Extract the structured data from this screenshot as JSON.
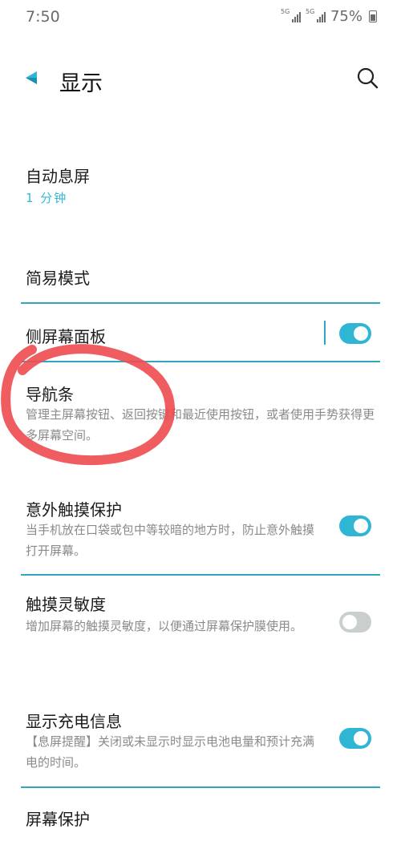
{
  "status_bar": {
    "time": "7:50",
    "sim1": "5G",
    "sim2": "5G",
    "battery": "75%"
  },
  "header": {
    "title": "显示"
  },
  "items": [
    {
      "title": "自动息屏",
      "value": "1 分钟"
    },
    {
      "title": "简易模式"
    },
    {
      "title": "侧屏幕面板",
      "toggle": "on"
    },
    {
      "title": "导航条",
      "subtitle": "管理主屏幕按钮、返回按键和最近使用按钮，或者使用手势获得更多屏幕空间。"
    },
    {
      "title": "意外触摸保护",
      "subtitle": "当手机放在口袋或包中等较暗的地方时，防止意外触摸打开屏幕。",
      "toggle": "on"
    },
    {
      "title": "触摸灵敏度",
      "subtitle": "增加屏幕的触摸灵敏度，以便通过屏幕保护膜使用。",
      "toggle": "off"
    },
    {
      "title": "显示充电信息",
      "subtitle": "【息屏提醒】关闭或未显示时显示电池电量和预计充满电的时间。",
      "toggle": "on"
    },
    {
      "title": "屏幕保护"
    }
  ],
  "colors": {
    "accent": "#2fb6d4",
    "annotation": "#ee4b50",
    "toggle_off": "#c9cfcd"
  },
  "icons": {
    "back": "back-triangle-icon",
    "search": "search-icon"
  }
}
